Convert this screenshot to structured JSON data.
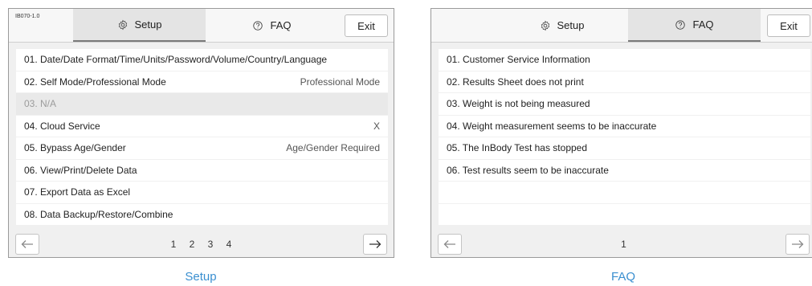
{
  "setup_screen": {
    "version": "IB070-1.0",
    "tabs": {
      "setup": "Setup",
      "faq": "FAQ",
      "exit": "Exit"
    },
    "rows": [
      {
        "label": "01. Date/Date Format/Time/Units/Password/Volume/Country/Language",
        "value": ""
      },
      {
        "label": "02. Self Mode/Professional Mode",
        "value": "Professional Mode"
      },
      {
        "label": "03. N/A",
        "value": ""
      },
      {
        "label": "04. Cloud Service",
        "value": "X"
      },
      {
        "label": "05. Bypass Age/Gender",
        "value": "Age/Gender Required"
      },
      {
        "label": "06. View/Print/Delete Data",
        "value": ""
      },
      {
        "label": "07. Export Data as Excel",
        "value": ""
      },
      {
        "label": "08. Data Backup/Restore/Combine",
        "value": ""
      }
    ],
    "pages": [
      "1",
      "2",
      "3",
      "4"
    ],
    "caption": "Setup"
  },
  "faq_screen": {
    "tabs": {
      "setup": "Setup",
      "faq": "FAQ",
      "exit": "Exit"
    },
    "rows": [
      {
        "label": "01. Customer Service Information"
      },
      {
        "label": "02. Results Sheet does not print"
      },
      {
        "label": "03. Weight is not being measured"
      },
      {
        "label": "04. Weight measurement seems to be inaccurate"
      },
      {
        "label": "05. The InBody Test has stopped"
      },
      {
        "label": "06. Test results seem to be inaccurate"
      },
      {
        "label": ""
      },
      {
        "label": ""
      }
    ],
    "pages": [
      "1"
    ],
    "caption": "FAQ"
  },
  "icons": {
    "setup": "gear-icon",
    "faq": "question-circle-icon",
    "prev": "arrow-left-icon",
    "next": "arrow-right-icon"
  },
  "colors": {
    "caption": "#3a8fd0",
    "active_tab": "#e4e4e4",
    "disabled_row": "#e9e9e9"
  }
}
